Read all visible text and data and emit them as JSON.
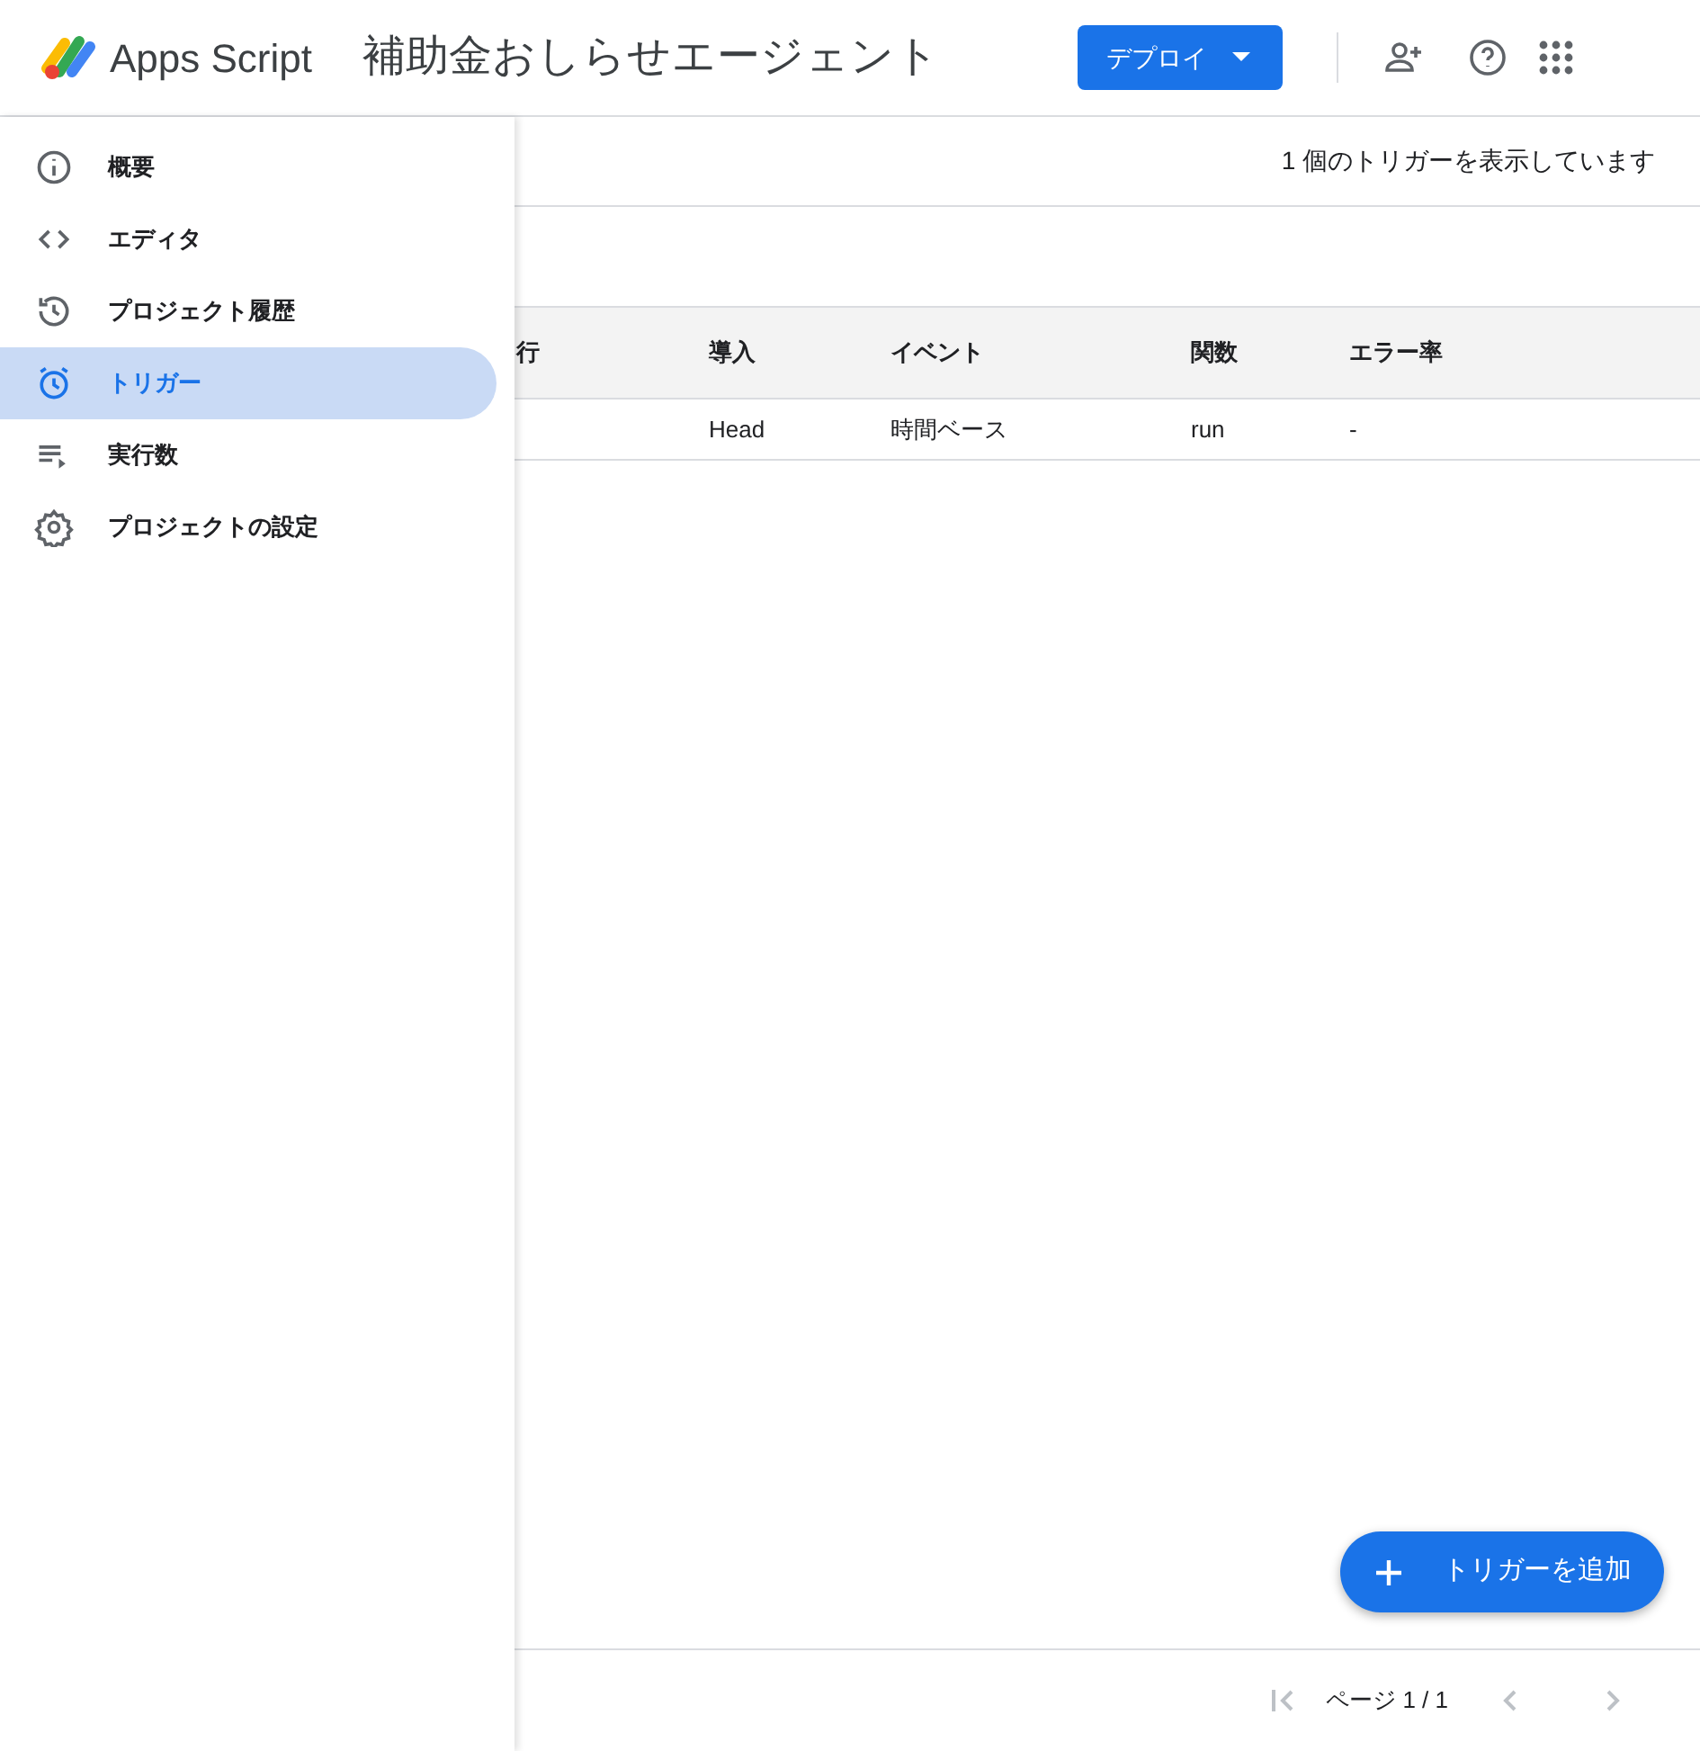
{
  "header": {
    "product": "Apps Script",
    "project_title": "補助金おしらせエージェント",
    "deploy_button": "デプロイ"
  },
  "sidebar": {
    "items": [
      {
        "label": "概要",
        "selected": false
      },
      {
        "label": "エディタ",
        "selected": false
      },
      {
        "label": "プロジェクト履歴",
        "selected": false
      },
      {
        "label": "トリガー",
        "selected": true
      },
      {
        "label": "実行数",
        "selected": false
      },
      {
        "label": "プロジェクトの設定",
        "selected": false
      }
    ]
  },
  "summary": "1 個のトリガーを表示しています",
  "table": {
    "columns": [
      "行",
      "導入",
      "イベント",
      "関数",
      "エラー率"
    ],
    "rows": [
      [
        "",
        "Head",
        "時間ベース",
        "run",
        "-"
      ]
    ]
  },
  "add_button": "トリガーを追加",
  "pagination": {
    "label": "ページ 1 / 1"
  }
}
